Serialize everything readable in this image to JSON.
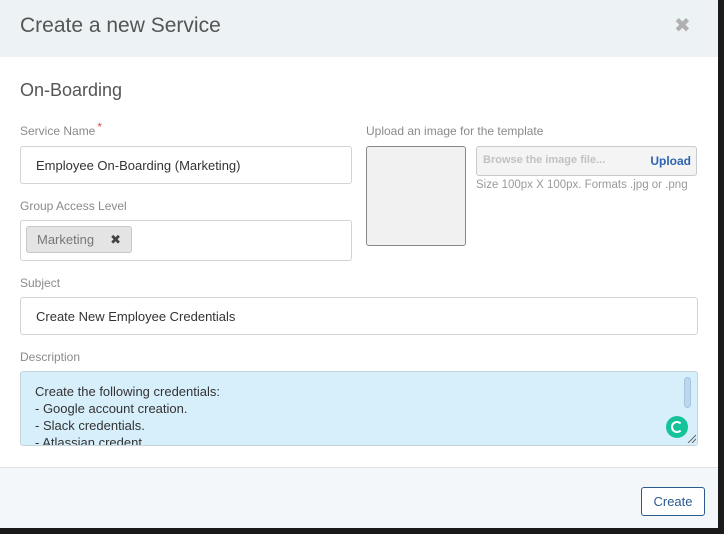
{
  "modal": {
    "title": "Create a new Service",
    "close_icon": "close-icon"
  },
  "section_title": "On-Boarding",
  "service_name": {
    "label": "Service Name",
    "required_marker": "*",
    "value": "Employee On-Boarding (Marketing)"
  },
  "group_access": {
    "label": "Group Access Level",
    "tags": [
      {
        "label": "Marketing",
        "remove_glyph": "✖"
      }
    ]
  },
  "upload": {
    "label": "Upload an image for the template",
    "placeholder": "Browse the image file...",
    "button_label": "Upload",
    "helper_text": "Size 100px X 100px. Formats .jpg or .png"
  },
  "subject": {
    "label": "Subject",
    "value": "Create New Employee Credentials"
  },
  "description": {
    "label": "Description",
    "lines": [
      "Create the following credentials:",
      "- Google account creation.",
      "- Slack credentials.",
      "- Atlassian credent"
    ]
  },
  "footer": {
    "create_label": "Create"
  },
  "colors": {
    "header_bg": "#edf2f5",
    "textarea_bg": "#d7eefb",
    "accent": "#2b5a8f",
    "grammarly": "#15c39a"
  }
}
